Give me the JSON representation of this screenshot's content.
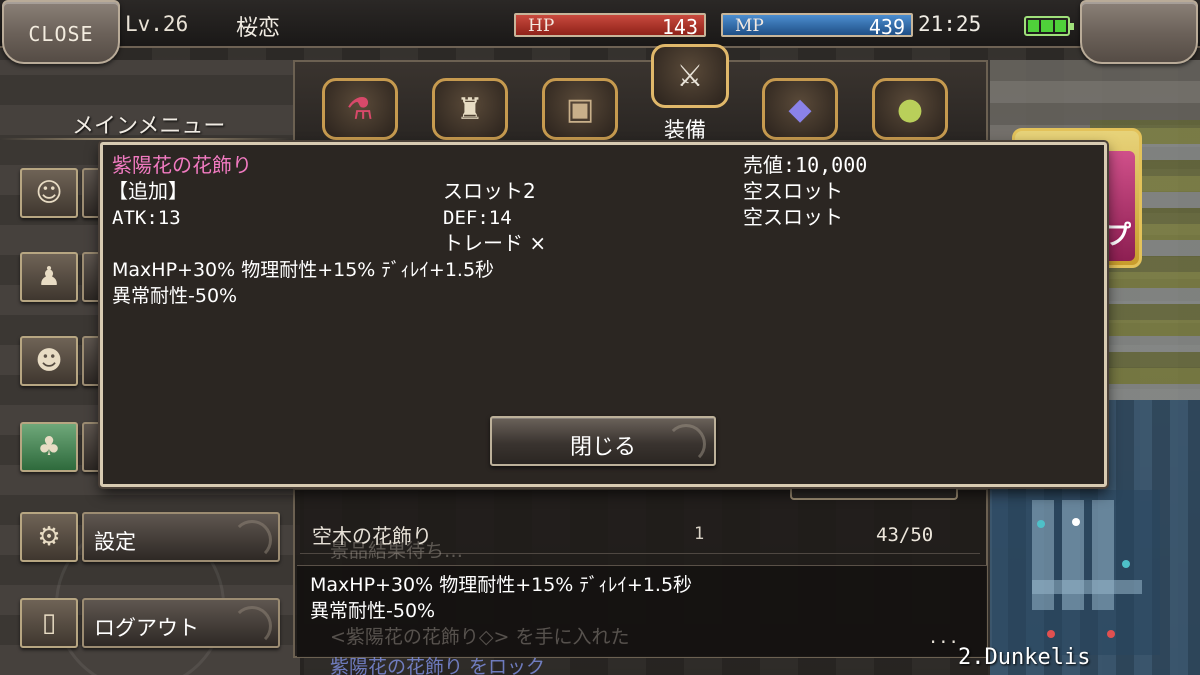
{
  "topbar": {
    "close_label": "CLOSE",
    "level": "Lv.26",
    "player_name": "桜恋",
    "hp_label": "HP",
    "hp_value": "143",
    "mp_label": "MP",
    "mp_value": "439",
    "time": "21:25",
    "battery_icon": "battery-full-icon"
  },
  "main_menu": {
    "title": "メインメニュー",
    "items": [
      {
        "icon": "character-icon",
        "label": ""
      },
      {
        "icon": "item-bag-icon",
        "label": ""
      },
      {
        "icon": "party-icon",
        "label": ""
      },
      {
        "icon": "island-icon",
        "label": ""
      },
      {
        "icon": "settings-icon",
        "label": "設定"
      },
      {
        "icon": "door-icon",
        "label": "ログアウト"
      }
    ]
  },
  "tabs": {
    "items": [
      {
        "icon": "potion-icon"
      },
      {
        "icon": "pouch-icon"
      },
      {
        "icon": "chest-icon"
      },
      {
        "icon": "sword-icon",
        "label": "装備",
        "active": true
      },
      {
        "icon": "crystal-icon"
      },
      {
        "icon": "orb-icon"
      }
    ]
  },
  "popup": {
    "item_name": "紫陽花の花飾り",
    "added_label": "【追加】",
    "atk": "ATK:13",
    "slot": "スロット2",
    "def": "DEF:14",
    "trade": "トレード ×",
    "sell_price": "売値:10,000",
    "empty_slot_1": "空スロット",
    "empty_slot_2": "空スロット",
    "effects_line1": "MaxHP+30% 物理耐性+15% ﾃﾞｨﾚｲ+1.5秒",
    "effects_line2": "異常耐性-50%",
    "close_button": "閉じる"
  },
  "inventory_list": {
    "rows": [
      {
        "name": "空木の花飾り",
        "qty": "1",
        "capacity": "43/50"
      }
    ]
  },
  "item_detail": {
    "line1": "MaxHP+30% 物理耐性+15% ﾃﾞｨﾚｲ+1.5秒",
    "line2": "異常耐性-50%",
    "more": "..."
  },
  "chat_log": {
    "line1": "景品結果待ち…",
    "line2": "<紫陽花の花飾り◇> を手に入れた",
    "line3": "紫陽花の花飾り をロック"
  },
  "minimap": {
    "location": "2.Dunkelis"
  },
  "side_badge": {
    "text": "プ"
  }
}
